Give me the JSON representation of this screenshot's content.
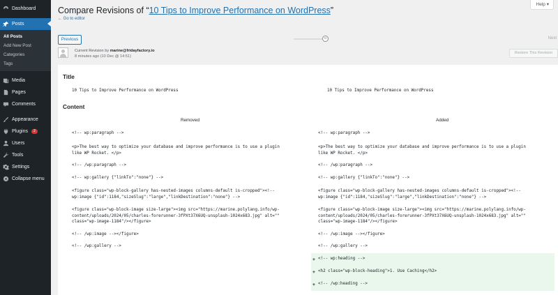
{
  "sidebar": {
    "items": [
      {
        "label": "Dashboard",
        "icon": "dashboard-icon"
      },
      {
        "label": "Posts",
        "icon": "pin-icon"
      },
      {
        "label": "Media",
        "icon": "media-icon"
      },
      {
        "label": "Pages",
        "icon": "pages-icon"
      },
      {
        "label": "Comments",
        "icon": "comments-icon"
      },
      {
        "label": "Appearance",
        "icon": "brush-icon"
      },
      {
        "label": "Plugins",
        "icon": "plugin-icon",
        "badge": "2"
      },
      {
        "label": "Users",
        "icon": "users-icon"
      },
      {
        "label": "Tools",
        "icon": "wrench-icon"
      },
      {
        "label": "Settings",
        "icon": "settings-icon"
      },
      {
        "label": "Collapse menu",
        "icon": "collapse-icon"
      }
    ],
    "submenu": [
      "All Posts",
      "Add New Post",
      "Categories",
      "Tags"
    ]
  },
  "header": {
    "help": "Help",
    "title_prefix": "Compare Revisions of “",
    "title_link": "10 Tips to Improve Performance on WordPress",
    "title_suffix": "”",
    "goto_editor": "← Go to editor"
  },
  "nav": {
    "previous": "Previous",
    "next": "Next"
  },
  "revision": {
    "label": "Current Revision by",
    "author": "marine@fridayfactory.io",
    "time": "8 minutes ago (10 Dec @ 14:51)",
    "restore": "Restore This Revision"
  },
  "diff": {
    "title_heading": "Title",
    "title_left": "10 Tips to Improve Performance on WordPress",
    "title_right": "10 Tips to Improve Performance on WordPress",
    "content_heading": "Content",
    "removed_label": "Removed",
    "added_label": "Added",
    "left_lines": [
      "<!-- wp:paragraph -->",
      "<p>The best way to optimize your database and improve performance is to use a plugin\nlike WP Rocket. </p>",
      "<!-- /wp:paragraph -->",
      "<!-- wp:gallery {\"linkTo\":\"none\"} -->",
      "<figure class=\"wp-block-gallery has-nested-images columns-default is-cropped\"><!--\nwp:image {\"id\":1184,\"sizeSlug\":\"large\",\"linkDestination\":\"none\"} -->",
      "<figure class=\"wp-block-image size-large\"><img src=\"https://marine.polylang.info/wp-\ncontent/uploads/2024/05/charles-forerunner-3fPXt37X6UQ-unsplash-1024x683.jpg\" alt=\"\"\nclass=\"wp-image-1184\"/></figure>",
      "<!-- /wp:image --></figure>",
      "<!-- /wp:gallery -->"
    ],
    "right_lines": [
      "<!-- wp:paragraph -->",
      "<p>The best way to optimize your database and improve performance is to use a plugin\nlike WP Rocket. </p>",
      "<!-- /wp:paragraph -->",
      "<!-- wp:gallery {\"linkTo\":\"none\"} -->",
      "<figure class=\"wp-block-gallery has-nested-images columns-default is-cropped\"><!--\nwp:image {\"id\":1184,\"sizeSlug\":\"large\",\"linkDestination\":\"none\"} -->",
      "<figure class=\"wp-block-image size-large\"><img src=\"https://marine.polylang.info/wp-\ncontent/uploads/2024/05/charles-forerunner-3fPXt37X6UQ-unsplash-1024x683.jpg\" alt=\"\"\nclass=\"wp-image-1184\"/></figure>",
      "<!-- /wp:image --></figure>",
      "<!-- /wp:gallery -->"
    ],
    "added_marker": "+",
    "added_lines": [
      "<!-- wp:heading -->",
      "<h2 class=\"wp-block-heading\">1. Use Caching</h2>",
      "<!-- /wp:heading -->"
    ]
  },
  "colors": {
    "sidebar_bg": "#1d2327",
    "active": "#2271b1",
    "added_bg": "#e9f7ec"
  }
}
